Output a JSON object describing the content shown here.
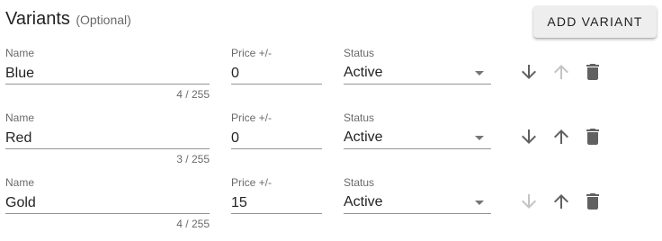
{
  "header": {
    "title": "Variants",
    "optional": "(Optional)",
    "add_button_label": "ADD VARIANT"
  },
  "labels": {
    "name": "Name",
    "price": "Price +/-",
    "status": "Status"
  },
  "colors": {
    "icon_enabled": "#616161",
    "icon_disabled": "#c4c4c4"
  },
  "icons": [
    "arrow-down-icon",
    "arrow-up-icon",
    "trash-icon",
    "dropdown-caret-icon"
  ],
  "variants": [
    {
      "name": "Blue",
      "name_counter": "4 / 255",
      "price": "0",
      "status": "Active",
      "move_down_enabled": true,
      "move_up_enabled": false
    },
    {
      "name": "Red",
      "name_counter": "3 / 255",
      "price": "0",
      "status": "Active",
      "move_down_enabled": true,
      "move_up_enabled": true
    },
    {
      "name": "Gold",
      "name_counter": "4 / 255",
      "price": "15",
      "status": "Active",
      "move_down_enabled": false,
      "move_up_enabled": true
    }
  ]
}
